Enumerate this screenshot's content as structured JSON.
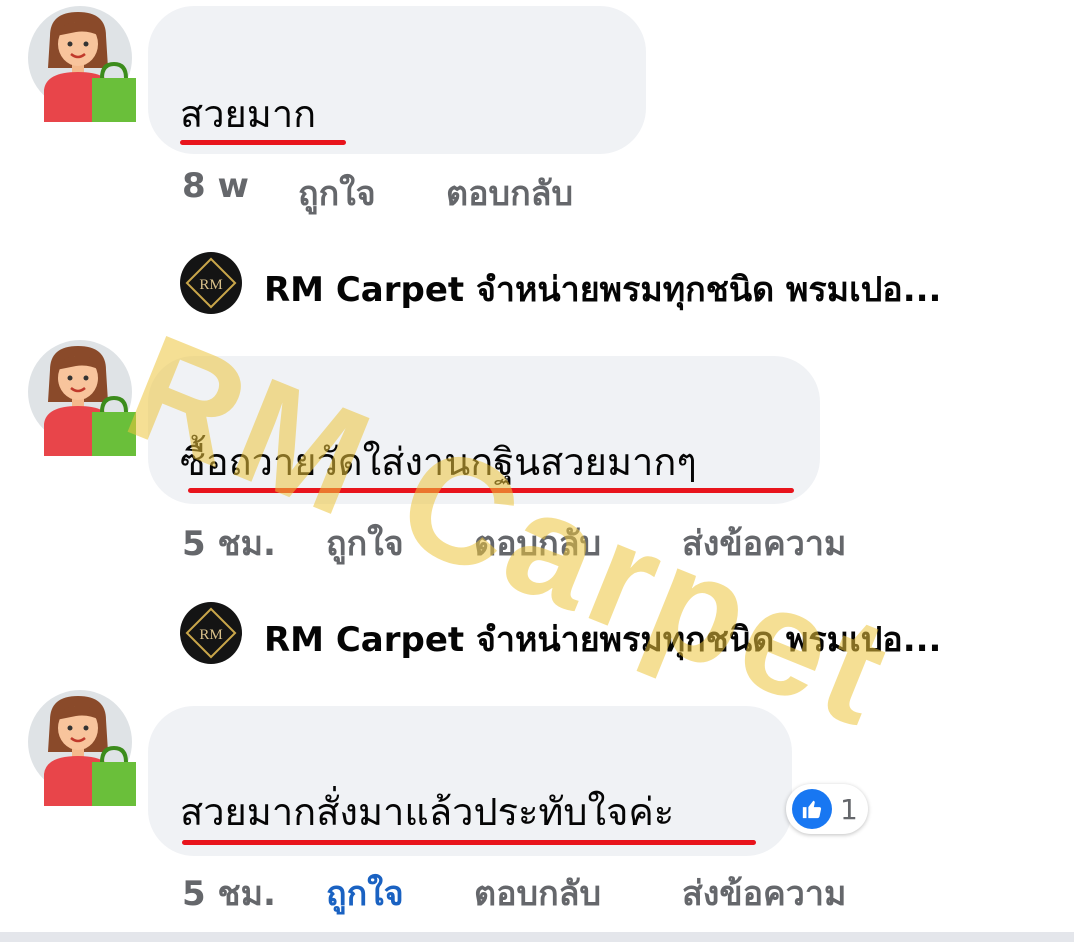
{
  "watermark": "RM Carpet",
  "comments": [
    {
      "text": "สวยมาก",
      "time": "8 w",
      "like_label": "ถูกใจ",
      "reply_label": "ตอบกลับ"
    },
    {
      "page_name": "RM Carpet จำหน่ายพรมทุกชนิด พรมเปอ...",
      "text": "ซื้อถวายวัดใส่งานกฐินสวยมากๆ",
      "time": "5 ชม.",
      "like_label": "ถูกใจ",
      "reply_label": "ตอบกลับ",
      "message_label": "ส่งข้อความ"
    },
    {
      "page_name": "RM Carpet จำหน่ายพรมทุกชนิด พรมเปอ...",
      "text": "สวยมากสั่งมาแล้วประทับใจค่ะ",
      "time": "5 ชม.",
      "like_label": "ถูกใจ",
      "reply_label": "ตอบกลับ",
      "message_label": "ส่งข้อความ",
      "reaction_count": "1",
      "liked": true
    }
  ],
  "colors": {
    "bubble": "#f0f2f5",
    "underline": "#e8141c",
    "meta": "#65676b",
    "liked": "#1a62c2",
    "like_icon": "#1877f2",
    "watermark": "#ecc43c"
  },
  "icons": {
    "avatar": "shopper-avatar-icon",
    "page_avatar": "rm-carpet-logo",
    "reaction": "thumbs-up-icon"
  }
}
